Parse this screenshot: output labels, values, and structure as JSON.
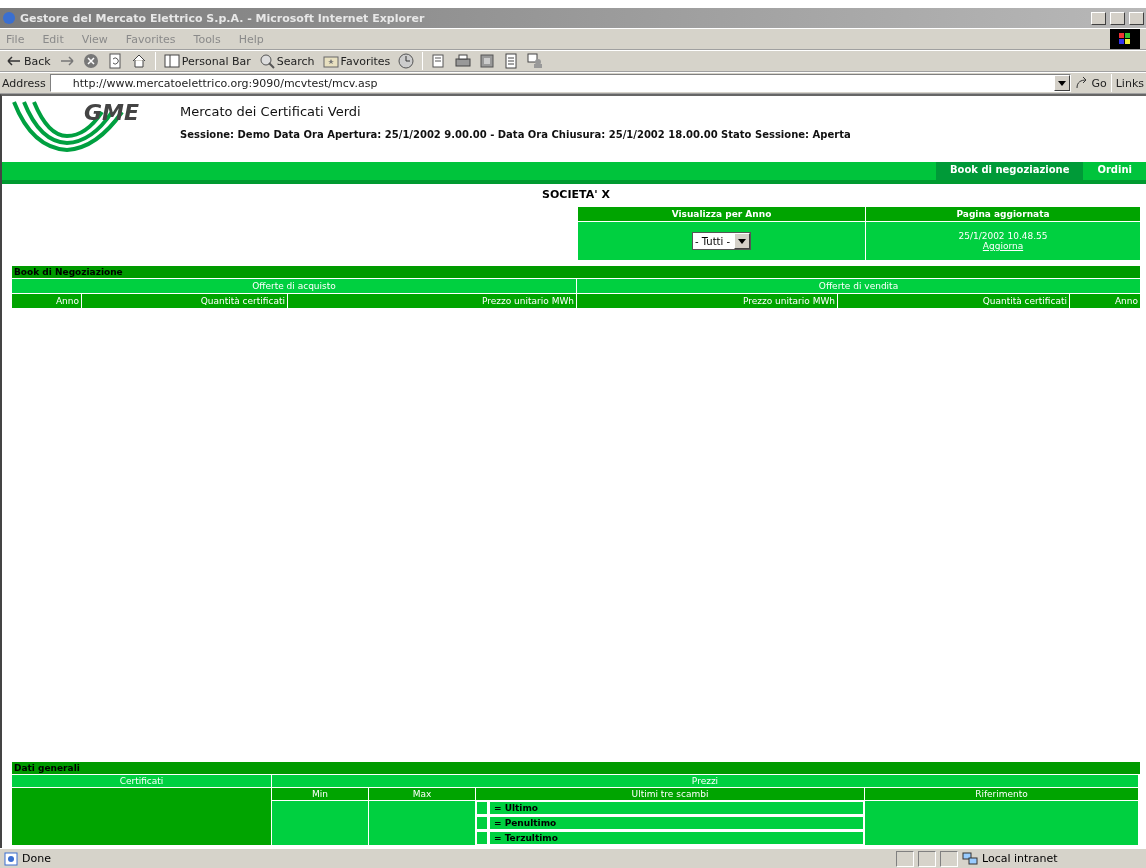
{
  "window": {
    "title": "Gestore del Mercato Elettrico S.p.A. - Microsoft Internet Explorer"
  },
  "menu": [
    "File",
    "Edit",
    "View",
    "Favorites",
    "Tools",
    "Help"
  ],
  "toolbar": [
    {
      "kind": "back",
      "label": "Back"
    },
    {
      "kind": "forward"
    },
    {
      "kind": "stop"
    },
    {
      "kind": "refresh"
    },
    {
      "kind": "home"
    },
    {
      "kind": "sep"
    },
    {
      "kind": "panel",
      "label": "Personal Bar"
    },
    {
      "kind": "search",
      "label": "Search"
    },
    {
      "kind": "favorites",
      "label": "Favorites"
    },
    {
      "kind": "history"
    },
    {
      "kind": "sep"
    },
    {
      "kind": "mail"
    },
    {
      "kind": "print"
    },
    {
      "kind": "edit"
    },
    {
      "kind": "page"
    },
    {
      "kind": "discuss"
    }
  ],
  "address": {
    "label": "Address",
    "value": "http://www.mercatoelettrico.org:9090/mcvtest/mcv.asp",
    "go": "Go",
    "links": "Links"
  },
  "page": {
    "logo": "GME",
    "title": "Mercato dei Certificati Verdi",
    "session": "Sessione: Demo Data Ora Apertura: 25/1/2002 9.00.00 - Data Ora Chiusura: 25/1/2002 18.00.00 Stato Sessione: Aperta",
    "nav": [
      {
        "label": "Book di negoziazione",
        "selected": true
      },
      {
        "label": "Ordini",
        "selected": false
      }
    ],
    "company": "SOCIETA' X",
    "filter": {
      "year_header": "Visualizza per Anno",
      "year_value": "- Tutti -",
      "updated_header": "Pagina aggiornata",
      "updated_value": "25/1/2002 10.48.55",
      "refresh_link": "Aggiorna"
    },
    "book": {
      "title": "Book di Negoziazione",
      "groups": [
        "Offerte di acquisto",
        "Offerte di vendita"
      ],
      "columns": [
        "Anno",
        "Quantità certificati",
        "Prezzo unitario MWh",
        "Prezzo unitario MWh",
        "Quantità certificati",
        "Anno"
      ]
    },
    "general": {
      "title": "Dati generali",
      "certificates": "Certificati",
      "prices": "Prezzi",
      "min": "Min",
      "max": "Max",
      "last_trades": "Ultimi tre scambi",
      "reference": "Riferimento",
      "trades": [
        "= Ultimo",
        "= Penultimo",
        "= Terzultimo"
      ]
    }
  },
  "status_bar": {
    "text": "Done",
    "zone": "Local intranet"
  }
}
